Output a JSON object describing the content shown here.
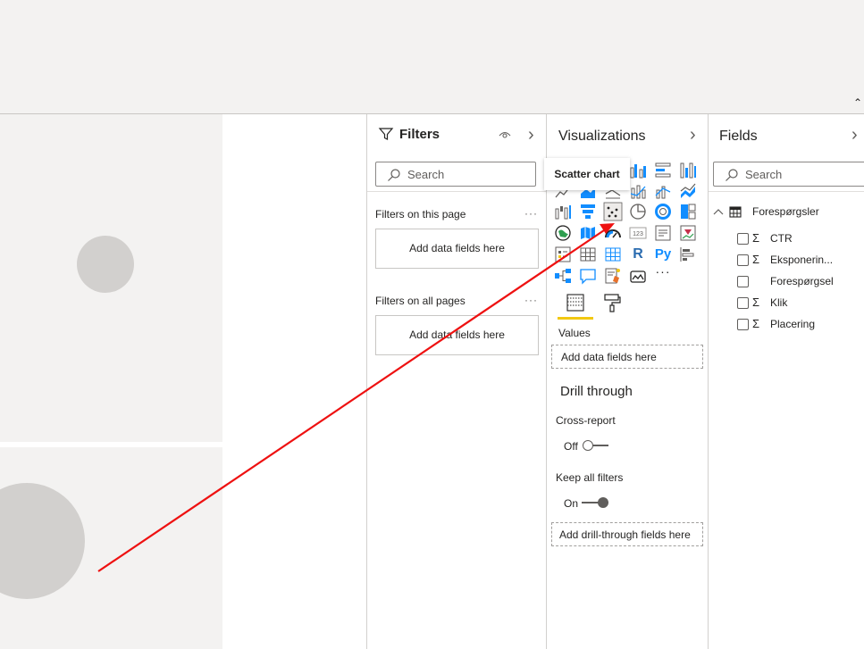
{
  "ribbon": {
    "collapse_icon": "chevron-up-icon",
    "collapse_glyph": "⌃"
  },
  "filters": {
    "title": "Filters",
    "search_placeholder": "Search",
    "on_this_page_label": "Filters on this page",
    "on_this_page_drop": "Add data fields here",
    "on_all_pages_label": "Filters on all pages",
    "on_all_pages_drop": "Add data fields here",
    "more": "···",
    "chevron": "›"
  },
  "visualizations": {
    "title": "Visualizations",
    "chevron": "›",
    "tooltip": "Scatter chart",
    "more": "···",
    "r_label": "R",
    "py_label": "Py",
    "card_label": "123",
    "values_label": "Values",
    "values_drop": "Add data fields here",
    "drill_title": "Drill through",
    "cross_report_label": "Cross-report",
    "cross_report_state": "Off",
    "keep_filters_label": "Keep all filters",
    "keep_filters_state": "On",
    "drill_drop": "Add drill-through fields here",
    "accent": "#f2c811"
  },
  "fields": {
    "title": "Fields",
    "chevron": "›",
    "search_placeholder": "Search",
    "table_name": "Forespørgsler",
    "items": [
      {
        "name": "CTR",
        "sigma": "Σ"
      },
      {
        "name": "Eksponerin...",
        "sigma": "Σ"
      },
      {
        "name": "Forespørgsel",
        "sigma": ""
      },
      {
        "name": "Klik",
        "sigma": "Σ"
      },
      {
        "name": "Placering",
        "sigma": "Σ"
      }
    ]
  },
  "annotation": {
    "arrow_color": "#ee1111"
  }
}
